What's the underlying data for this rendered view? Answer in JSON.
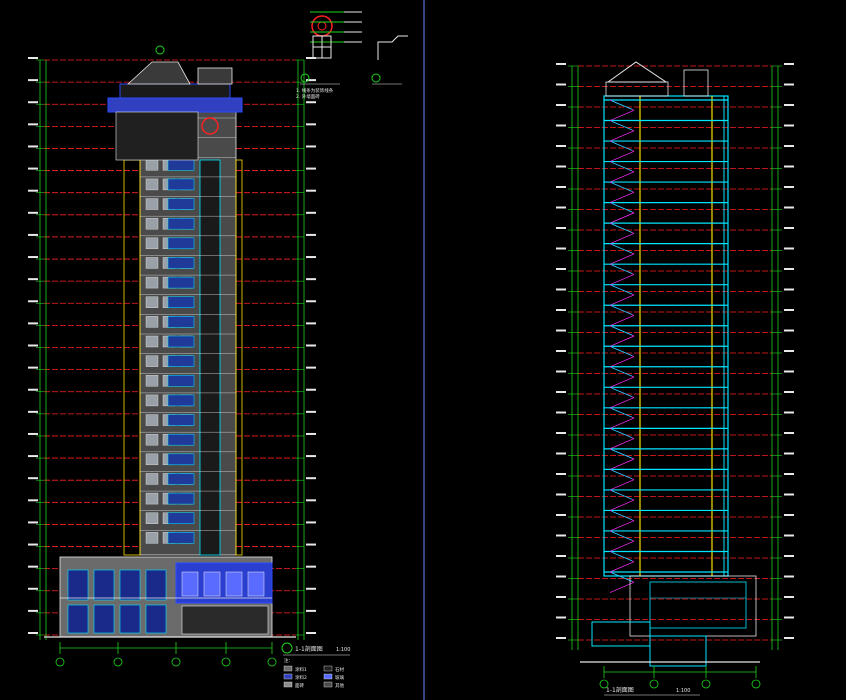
{
  "title_left": "1-1剖面图",
  "scale_left": "1:100",
  "section_title": "1-1剖面图",
  "scale_right": "1:100",
  "note_1": "注：",
  "note_detail_a": "1. 线条为装饰线条",
  "note_detail_b": "2. 外墙面砖",
  "legend_items": [
    "涂料1",
    "涂料2",
    "面砖",
    "石材",
    "玻璃",
    "其他"
  ],
  "colors": {
    "bg": "#000000",
    "white": "#e8e8e8",
    "red": "#ff2020",
    "green": "#1fd41f",
    "blue": "#2b4bff",
    "cyan": "#00e5ff",
    "yellow": "#ffe000",
    "magenta": "#ff30ff",
    "gray": "#8c8c8c",
    "orange": "#ff8c00"
  },
  "icons": [
    "detail-circle-icon",
    "section-marker-icon"
  ]
}
